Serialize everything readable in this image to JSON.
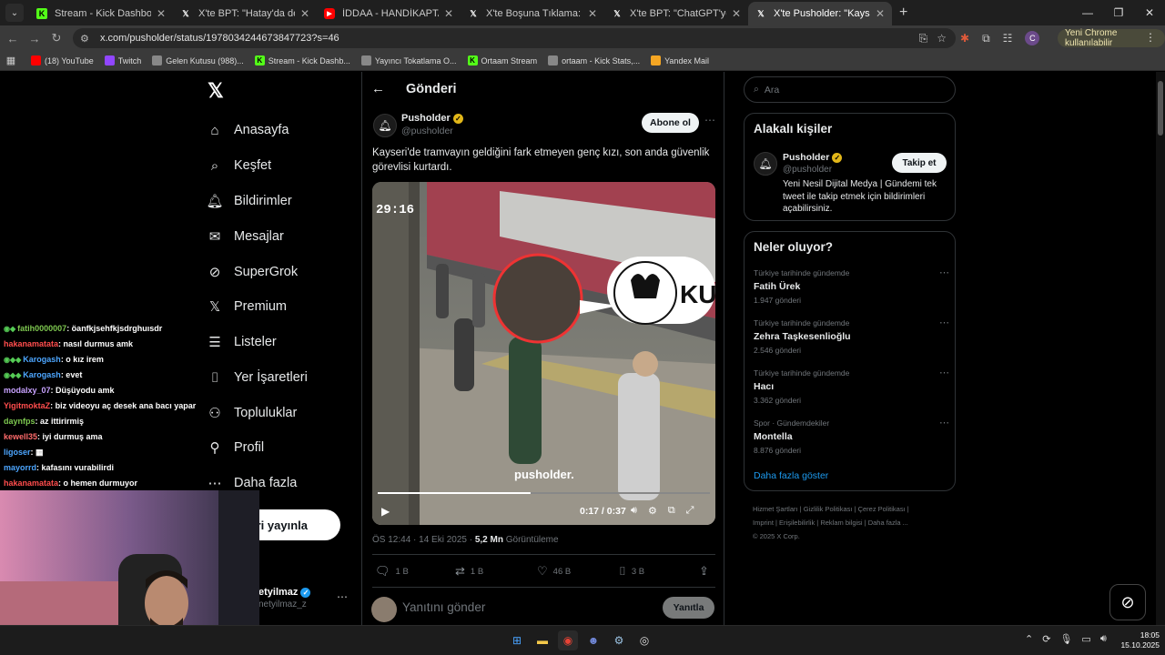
{
  "browser": {
    "tabs": [
      {
        "icon": "kick-icon",
        "icon_color": "#53fc18",
        "title": "Stream - Kick Dashboard",
        "active": false
      },
      {
        "icon": "x-icon",
        "icon_color": "#ffffff",
        "title": "X'te BPT: \"Hatay'da depremin o",
        "active": false
      },
      {
        "icon": "youtube-icon",
        "icon_color": "#ff0000",
        "title": "İDDAA - HANDİKAPTAN KAZAN",
        "active": false
      },
      {
        "icon": "x-icon",
        "icon_color": "#ffffff",
        "title": "X'te Boşuna Tıklama: \"Japonya'",
        "active": false
      },
      {
        "icon": "x-icon",
        "icon_color": "#ffffff",
        "title": "X'te BPT: \"ChatGPT'ye cinsel içe",
        "active": false
      },
      {
        "icon": "x-icon",
        "icon_color": "#ffffff",
        "title": "X'te Pusholder: \"Kayseri'de tran",
        "active": true
      }
    ],
    "new_tab": "+",
    "url": "x.com/pusholder/status/1978034244673847723?s=46",
    "profile_initial": "C",
    "profile_chip": "Yeni Chrome kullanılabilir",
    "bookmarks": [
      {
        "icon": "youtube-icon",
        "color": "#ff0000",
        "label": "(18) YouTube"
      },
      {
        "icon": "twitch-icon",
        "color": "#9146ff",
        "label": "Twitch"
      },
      {
        "icon": "mail-icon",
        "color": "#888888",
        "label": "Gelen Kutusu (988)..."
      },
      {
        "icon": "kick-icon",
        "color": "#53fc18",
        "label": "Stream - Kick Dashb..."
      },
      {
        "icon": "globe-icon",
        "color": "#888888",
        "label": "Yayıncı Tokatlama O..."
      },
      {
        "icon": "kick-icon",
        "color": "#53fc18",
        "label": "Ortaam Stream"
      },
      {
        "icon": "globe-icon",
        "color": "#888888",
        "label": "ortaam - Kick Stats,..."
      },
      {
        "icon": "yandex-mail-icon",
        "color": "#f5a623",
        "label": "Yandex Mail"
      }
    ]
  },
  "nav": {
    "items": [
      {
        "icon": "home-icon",
        "glyph": "⌂",
        "label": "Anasayfa"
      },
      {
        "icon": "search-icon",
        "glyph": "⌕",
        "label": "Keşfet"
      },
      {
        "icon": "bell-icon",
        "glyph": "🔔︎",
        "label": "Bildirimler"
      },
      {
        "icon": "mail-icon",
        "glyph": "✉",
        "label": "Mesajlar"
      },
      {
        "icon": "grok-icon",
        "glyph": "⊘",
        "label": "SuperGrok"
      },
      {
        "icon": "x-icon",
        "glyph": "𝕏",
        "label": "Premium"
      },
      {
        "icon": "list-icon",
        "glyph": "☰",
        "label": "Listeler"
      },
      {
        "icon": "bookmark-icon",
        "glyph": "⌷",
        "label": "Yer İşaretleri"
      },
      {
        "icon": "people-icon",
        "glyph": "⚇",
        "label": "Topluluklar"
      },
      {
        "icon": "person-icon",
        "glyph": "⚲",
        "label": "Profil"
      },
      {
        "icon": "more-circle-icon",
        "glyph": "⋯",
        "label": "Daha fazla"
      }
    ],
    "post_label": "eri yayınla",
    "account_name": "etyilmaz",
    "account_handle": "netyilmaz_z"
  },
  "post": {
    "header": "Gönderi",
    "author": "Pusholder",
    "handle": "@pusholder",
    "subscribe": "Abone ol",
    "text": "Kayseri'de tramvayın geldiğini fark etmeyen genç kızı, son anda güvenlik görevlisi kurtardı.",
    "video": {
      "time": "0:17 / 0:37",
      "progress": 0.46,
      "watermark": "pusholder.",
      "overlay_text": "KU",
      "cam_time": "29:16"
    },
    "timestamp": "ÖS 12:44 · 14 Eki 2025 · ",
    "views": "5,2 Mn",
    "views_label": " Görüntüleme",
    "actions": {
      "replies": "1 B",
      "reposts": "1 B",
      "likes": "46 B",
      "bookmarks": "3 B"
    },
    "reply_placeholder": "Yanıtını gönder",
    "reply_button": "Yanıtla"
  },
  "sidebar": {
    "search_placeholder": "Ara",
    "related_title": "Alakalı kişiler",
    "related": {
      "name": "Pusholder",
      "handle": "@pusholder",
      "follow": "Takip et",
      "bio": "Yeni Nesil Dijital Medya | Gündemi tek tweet ile takip etmek için bildirimleri açabilirsiniz."
    },
    "trends_title": "Neler oluyor?",
    "trends": [
      {
        "context": "Türkiye tarihinde gündemde",
        "name": "Fatih Ürek",
        "count": "1.947 gönderi"
      },
      {
        "context": "Türkiye tarihinde gündemde",
        "name": "Zehra Taşkesenlioğlu",
        "count": "2.546 gönderi"
      },
      {
        "context": "Türkiye tarihinde gündemde",
        "name": "Hacı",
        "count": "3.362 gönderi"
      },
      {
        "context": "Spor · Gündemdekiler",
        "name": "Montella",
        "count": "8.876 gönderi"
      }
    ],
    "show_more": "Daha fazla göster",
    "footer": {
      "line1": "Hizmet Şartları  |  Gizlilik Politikası  |  Çerez Politikası  |",
      "line2": "Imprint  |  Erişilebilirlik  |  Reklam bilgisi  |  Daha fazla ...",
      "line3": "© 2025 X Corp."
    }
  },
  "chat": [
    {
      "user": "fatih0000007",
      "color": "#7ec850",
      "badges": "◉◆",
      "msg": ": öanfkjsehfkjsdrghuısdr"
    },
    {
      "user": "hakanamatata",
      "color": "#ff4d4d",
      "badges": "",
      "msg": ": nasıl durmus amk"
    },
    {
      "user": "Karogash",
      "color": "#4da6ff",
      "badges": "◉◆◆",
      "msg": ": o kız irem"
    },
    {
      "user": "Karogash",
      "color": "#4da6ff",
      "badges": "◉◆◆",
      "msg": ": evet"
    },
    {
      "user": "modalxy_07",
      "color": "#c8a2ff",
      "badges": "",
      "msg": ": Düşüyodu amk"
    },
    {
      "user": "YigitmoktaZ",
      "color": "#ff4d4d",
      "badges": "",
      "msg": ": biz videoyu aç desek ana bacı yapar"
    },
    {
      "user": "daynfps",
      "color": "#7ec850",
      "badges": "",
      "msg": ": az ittirirmiş"
    },
    {
      "user": "kewell35",
      "color": "#ff6b6b",
      "badges": "",
      "msg": ": iyi durmuş ama"
    },
    {
      "user": "ligoser",
      "color": "#4da6ff",
      "badges": "",
      "msg": ": ▦"
    },
    {
      "user": "mayorrd",
      "color": "#4da6ff",
      "badges": "",
      "msg": ": kafasını vurabilirdi"
    },
    {
      "user": "hakanamatata",
      "color": "#ff4d4d",
      "badges": "",
      "msg": ": o hemen durmuyor"
    }
  ],
  "taskbar": {
    "time": "18:05",
    "date": "15.10.2025"
  }
}
